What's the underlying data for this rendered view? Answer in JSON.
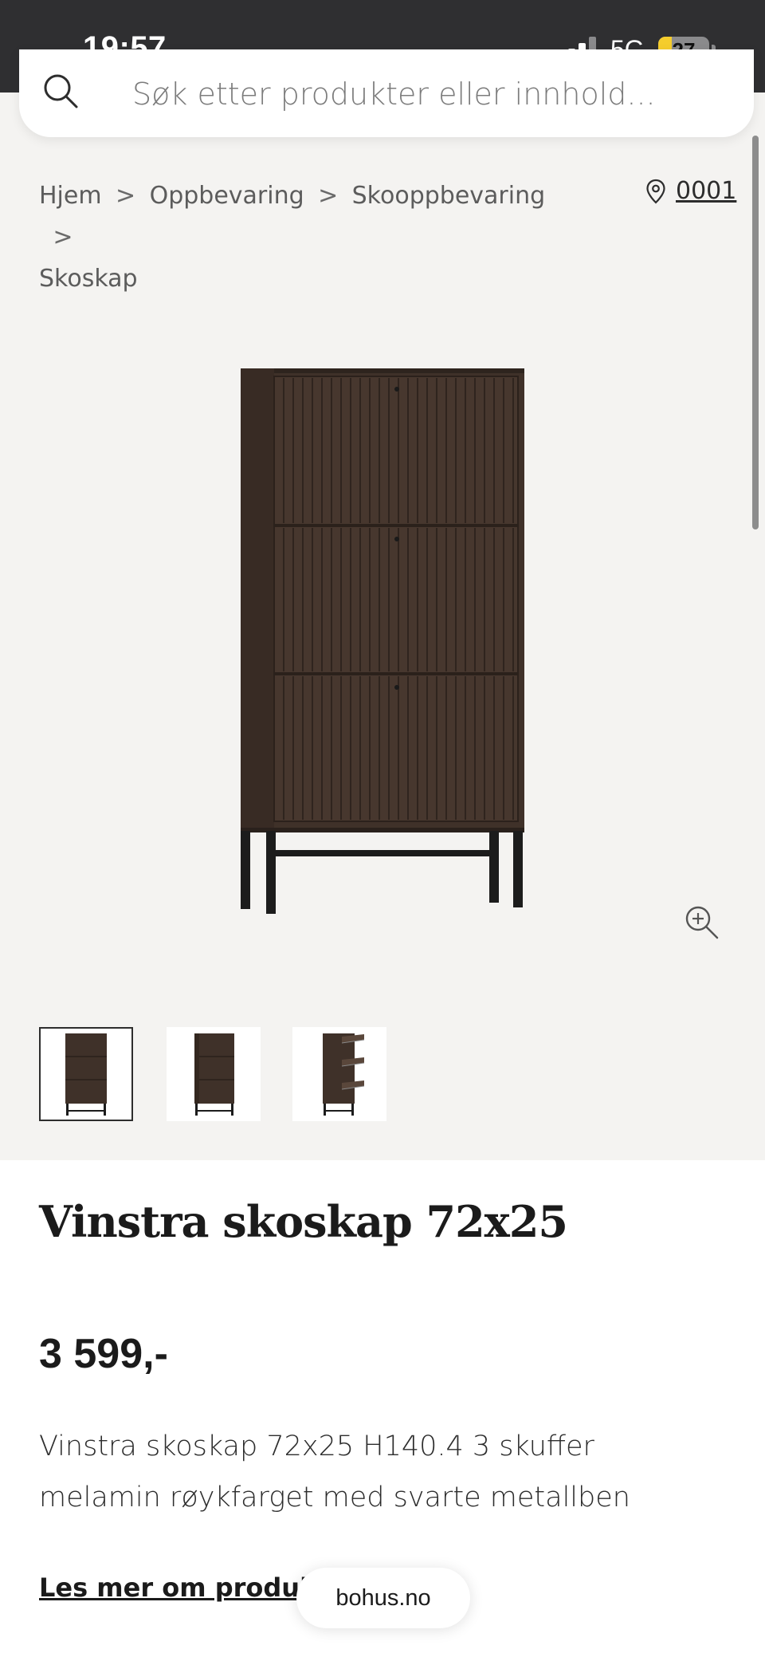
{
  "status_bar": {
    "time": "19:57",
    "network": "5G",
    "battery": "27",
    "battery_level": 0.27
  },
  "search": {
    "placeholder": "Søk etter produkter eller innhold...",
    "icon": "search-icon"
  },
  "breadcrumb": {
    "items": [
      "Hjem",
      "Oppbevaring",
      "Skooppbevaring",
      "Skoskap"
    ],
    "separator": ">"
  },
  "store": {
    "icon": "location-pin-icon",
    "label": "0001"
  },
  "gallery": {
    "zoom_icon": "zoom-in-icon",
    "thumbnail_count": 3,
    "active_thumbnail": 1
  },
  "product": {
    "title": "Vinstra skoskap 72x25",
    "price": "3 599,-",
    "description": "Vinstra skoskap 72x25 H140.4 3 skuffer melamin røykfarget med svarte metallben",
    "read_more": "Les mer om produktet"
  },
  "footer": {
    "domain": "bohus.no"
  },
  "colors": {
    "status_bar": "#2f2f31",
    "page_background": "#f4f3f1",
    "battery_fill": "#f5cd2c",
    "cabinet_wood": "#3f3129",
    "text_dark": "#1b1b1b"
  }
}
